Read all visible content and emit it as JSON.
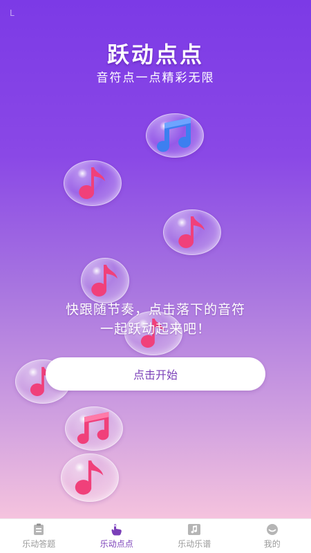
{
  "header": {
    "title": "跃动点点",
    "subtitle": "音符点一点精彩无限"
  },
  "status": {
    "corner_mark": "L"
  },
  "game": {
    "hint_line1": "快跟随节奏，点击落下的音符",
    "hint_line2": "一起跃动起来吧！",
    "start_label": "点击开始",
    "notes": [
      {
        "icon": "double-note-icon",
        "color": "#3d7ff0"
      },
      {
        "icon": "single-note-icon",
        "color": "#f0407a"
      },
      {
        "icon": "single-note-icon",
        "color": "#f0407a"
      },
      {
        "icon": "single-note-icon",
        "color": "#f0407a"
      },
      {
        "icon": "single-note-icon",
        "color": "#f0407a"
      },
      {
        "icon": "single-note-icon",
        "color": "#f0407a"
      },
      {
        "icon": "double-note-icon",
        "color": "#f0407a"
      },
      {
        "icon": "single-note-icon",
        "color": "#f0407a"
      }
    ]
  },
  "tabs": [
    {
      "label": "乐动答题",
      "icon": "quiz-icon",
      "active": false
    },
    {
      "label": "乐动点点",
      "icon": "tap-icon",
      "active": true
    },
    {
      "label": "乐动乐谱",
      "icon": "sheet-music-icon",
      "active": false
    },
    {
      "label": "我的",
      "icon": "profile-icon",
      "active": false
    }
  ],
  "colors": {
    "accent": "#7a3fb8",
    "blue_note": "#3d7ff0",
    "pink_note": "#f0407a"
  }
}
